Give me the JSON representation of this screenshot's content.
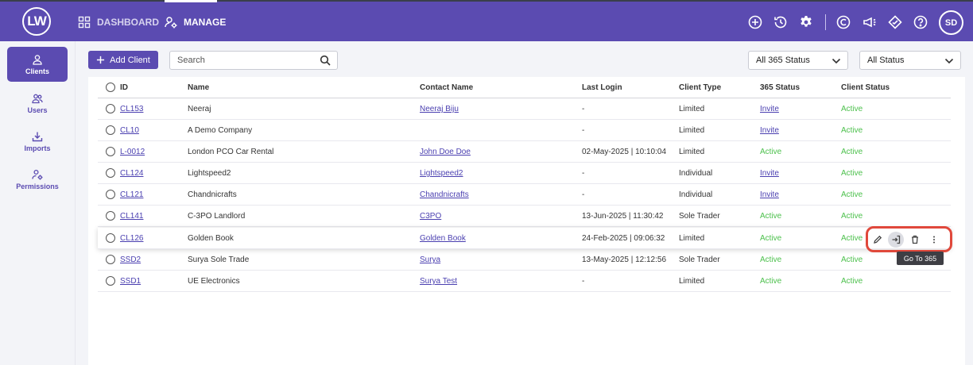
{
  "app": {
    "logo": "LW",
    "user_initials": "SD"
  },
  "nav": [
    {
      "label": "DASHBOARD",
      "icon": "grid-icon"
    },
    {
      "label": "MANAGE",
      "icon": "users-cog-icon"
    }
  ],
  "topbar_icons": [
    "add-circle-icon",
    "history-icon",
    "gear-icon",
    "c-logo-icon",
    "megaphone-icon",
    "diamond-icon",
    "help-icon"
  ],
  "sidebar": [
    {
      "label": "Clients",
      "icon": "user-icon",
      "active": true
    },
    {
      "label": "Users",
      "icon": "users-icon",
      "active": false
    },
    {
      "label": "Imports",
      "icon": "download-icon",
      "active": false
    },
    {
      "label": "Permissions",
      "icon": "user-gear-icon",
      "active": false
    }
  ],
  "toolbar": {
    "add_client_label": "Add Client",
    "search_placeholder": "Search",
    "filter_365": "All 365 Status",
    "filter_status": "All Status"
  },
  "table": {
    "headers": [
      "ID",
      "Name",
      "Contact Name",
      "Last Login",
      "Client Type",
      "365 Status",
      "Client Status"
    ],
    "rows": [
      {
        "id": "CL153",
        "name": "Neeraj",
        "contact": "Neeraj Biju",
        "last_login": "-",
        "type": "Limited",
        "s365": "Invite",
        "status": "Active"
      },
      {
        "id": "CL10",
        "name": "A Demo Company",
        "contact": "",
        "last_login": "-",
        "type": "Limited",
        "s365": "Invite",
        "status": "Active"
      },
      {
        "id": "L-0012",
        "name": "London PCO Car Rental",
        "contact": "John Doe Doe",
        "last_login": "02-May-2025 | 10:10:04",
        "type": "Limited",
        "s365": "Active",
        "status": "Active"
      },
      {
        "id": "CL124",
        "name": "Lightspeed2",
        "contact": "Lightspeed2",
        "last_login": "-",
        "type": "Individual",
        "s365": "Invite",
        "status": "Active"
      },
      {
        "id": "CL121",
        "name": "Chandnicrafts",
        "contact": "Chandnicrafts",
        "last_login": "-",
        "type": "Individual",
        "s365": "Invite",
        "status": "Active"
      },
      {
        "id": "CL141",
        "name": "C-3PO Landlord",
        "contact": "C3PO",
        "last_login": "13-Jun-2025 | 11:30:42",
        "type": "Sole Trader",
        "s365": "Active",
        "status": "Active"
      },
      {
        "id": "CL126",
        "name": "Golden Book",
        "contact": "Golden Book",
        "last_login": "24-Feb-2025 | 09:06:32",
        "type": "Limited",
        "s365": "Active",
        "status": "Active"
      },
      {
        "id": "SSD2",
        "name": "Surya Sole Trade",
        "contact": "Surya",
        "last_login": "13-May-2025 | 12:12:56",
        "type": "Sole Trader",
        "s365": "Active",
        "status": "Active"
      },
      {
        "id": "SSD1",
        "name": "UE Electronics",
        "contact": "Surya Test",
        "last_login": "-",
        "type": "Limited",
        "s365": "Active",
        "status": "Active"
      }
    ]
  },
  "row_actions": [
    "edit-icon",
    "go-to-365-icon",
    "delete-icon",
    "more-vertical-icon"
  ],
  "tooltip": "Go To 365",
  "colors": {
    "brand": "#5b4bb1",
    "active_green": "#4cc04c",
    "link": "#4a3fb0",
    "highlight": "#e0483b"
  }
}
